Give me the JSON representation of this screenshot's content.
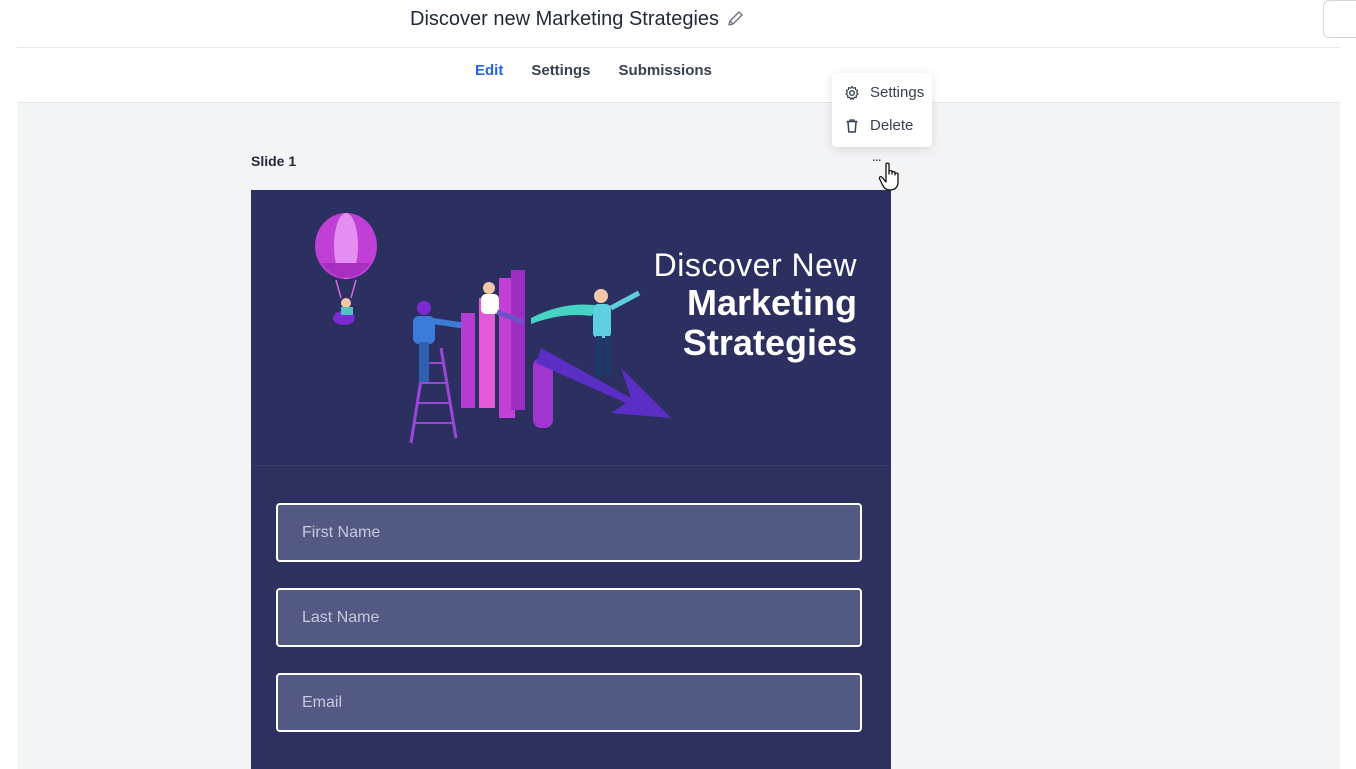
{
  "header": {
    "title": "Discover new Marketing Strategies",
    "edit_title_icon": "pencil-icon"
  },
  "tabs": [
    {
      "label": "Edit",
      "active": true
    },
    {
      "label": "Settings",
      "active": false
    },
    {
      "label": "Submissions",
      "active": false
    }
  ],
  "dropdown": {
    "items": [
      {
        "label": "Settings",
        "icon": "gear-icon"
      },
      {
        "label": "Delete",
        "icon": "trash-icon"
      }
    ]
  },
  "slide": {
    "label": "Slide 1",
    "more_label": "...",
    "hero": {
      "line1": "Discover New",
      "line2": "Marketing",
      "line3": "Strategies"
    },
    "fields": [
      {
        "placeholder": "First Name"
      },
      {
        "placeholder": "Last Name"
      },
      {
        "placeholder": "Email"
      }
    ]
  },
  "colors": {
    "accent": "#2563eb",
    "slide_bg": "#2d3160",
    "field_bg": "#525983",
    "canvas_bg": "#f3f4f6"
  }
}
